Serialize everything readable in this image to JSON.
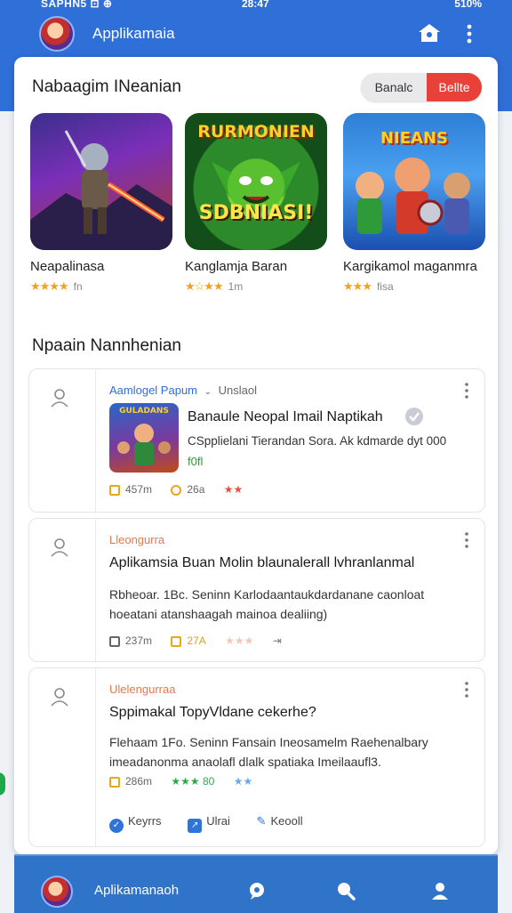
{
  "status_bar": {
    "left": "SAPHN5 ⊡ ⊕",
    "center": "28:47",
    "right": "510%"
  },
  "appbar": {
    "title": "Applikamaia"
  },
  "featured": {
    "title": "Nabaagim INeanian",
    "toggle": {
      "left": "Banalc",
      "right": "Bellte"
    },
    "games": [
      {
        "name": "Neapalinasa",
        "stars": "★★★★",
        "count": "fn",
        "art_text": ""
      },
      {
        "name": "Kanglamja Baran",
        "stars": "★☆★★",
        "count": "1m",
        "art_text_top": "RURMONIEN",
        "art_text_bottom": "SDBNIASI!"
      },
      {
        "name": "Kargikamol maganmra",
        "stars": "★★★",
        "count": "fisa",
        "art_text_top": "NIEANS"
      }
    ]
  },
  "feed": {
    "title": "Npaain Nannhenian",
    "posts": [
      {
        "author": "Aamlogel Papum",
        "status": "Unslaol",
        "headline": "Banaule Neopal Imail Naptikah",
        "body": "CSpplielani Tierandan Sora. Ak kdmarde dyt 000",
        "extra": "f0fl",
        "thumb_text": "GULADANS",
        "meta": [
          "457m",
          "26a",
          "★★"
        ]
      },
      {
        "tag": "Lleongurra",
        "headline": "Aplikamsia Buan Molin blaunalerall lvhranlanmal",
        "body": "Rbheoar. 1Bc. Seninn Karlodaantaukdardanane caonloat hoeatani atanshaagah mainoa dealiing)",
        "meta": [
          "237m",
          "27A",
          "★★★",
          "⇥"
        ]
      },
      {
        "tag": "Ulelengurraa",
        "headline": "Sppimakal TopyVldane cekerhe?",
        "body": "Flehaam 1Fo. Seninn Fansain Ineosamelm Raehenalbary imeadanonma anaolafl dlalk spatiaka Imeilaaufl3.",
        "meta": [
          "286m",
          "★★★ 80",
          "★★"
        ],
        "actions": [
          "Keyrrs",
          "Ulrai",
          "Keooll"
        ]
      }
    ]
  },
  "bottom_nav": {
    "label": "Aplikamanaoh"
  },
  "colors": {
    "brand_blue": "#2f6fd8",
    "accent_red": "#e8413a",
    "star_gold": "#f3a21a",
    "star_green": "#2fa84a"
  }
}
